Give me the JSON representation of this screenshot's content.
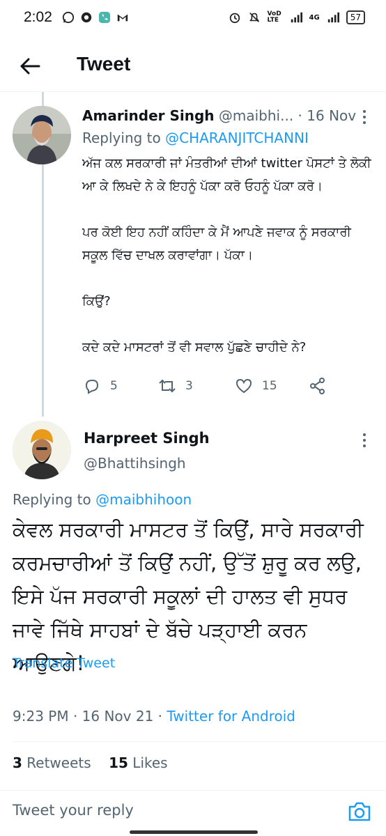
{
  "status_bar": {
    "time": "2:02",
    "carrier": "VoD LTE",
    "network": "4G",
    "battery": "57"
  },
  "header": {
    "title": "Tweet"
  },
  "tweet1": {
    "author_name": "Amarinder Singh",
    "author_handle": "@maibhi...",
    "date": "· 16 Nov",
    "replying_prefix": "Replying to ",
    "replying_to": "@CHARANJITCHANNI",
    "body": [
      "ਅੱਜ ਕਲ ਸਰਕਾਰੀ ਜਾਂ ਮੰਤਰੀਆਂ ਦੀਆਂ twitter ਪੋਸਟਾਂ ਤੇ ਲੋਕੀ ਆ ਕੇ ਲਿਖਦੇ ਨੇ ਕੇ ਇਹਨੂੰ ਪੱਕਾ ਕਰੋ ਓਹਨੂੰ ਪੱਕਾ ਕਰੋ।",
      "ਪਰ ਕੋਈ ਇਹ ਨਹੀਂ ਕਹਿੰਦਾ ਕੇ ਮੈਂ ਆਪਣੇ ਜਵਾਕ ਨੂੰ ਸਰਕਾਰੀ ਸਕੂਲ ਵਿੱਚ ਦਾਖਲ ਕਰਾਵਾਂਗਾ। ਪੱਕਾ।",
      "ਕਿਉਂ?",
      "ਕਦੇ ਕਦੇ ਮਾਸਟਰਾਂ ਤੋਂ ਵੀ ਸਵਾਲ ਪੁੱਛਣੇ ਚਾਹੀਦੇ ਨੇ?"
    ],
    "replies": "5",
    "retweets": "3",
    "likes": "15"
  },
  "tweet2": {
    "author_name": "Harpreet Singh",
    "author_handle": "@Bhattihsingh",
    "replying_prefix": "Replying to ",
    "replying_to": "@maibhihoon",
    "body": "ਕੇਵਲ ਸਰਕਾਰੀ ਮਾਸਟਰ ਤੋਂ ਕਿਉਂ, ਸਾਰੇ ਸਰਕਾਰੀ ਕਰਮਚਾਰੀਆਂ ਤੋਂ ਕਿਉਂ ਨਹੀਂ, ਉੱਤੋਂ ਸ਼ੁਰੂ ਕਰ ਲਉ, ਇਸੇ ਪੱਜ ਸਰਕਾਰੀ ਸਕੂਲਾਂ ਦੀ ਹਾਲਤ ਵੀ ਸੁਧਰ ਜਾਵੇ ਜਿੱਥੇ ਸਾਹਬਾਂ ਦੇ ਬੱਚੇ ਪੜ੍ਹਾਈ ਕਰਨ ਆਉਣਗੇ!",
    "translate_label": "Translate Tweet",
    "timestamp": "9:23 PM · 16 Nov 21 · ",
    "client": "Twitter for Android",
    "retweet_count": "3",
    "retweet_label": " Retweets",
    "like_count": "15",
    "like_label": " Likes"
  },
  "reply_bar": {
    "placeholder": "Tweet your reply"
  },
  "colors": {
    "accent": "#1d9bf0",
    "secondary_text": "#536471",
    "text": "#0f1419"
  }
}
